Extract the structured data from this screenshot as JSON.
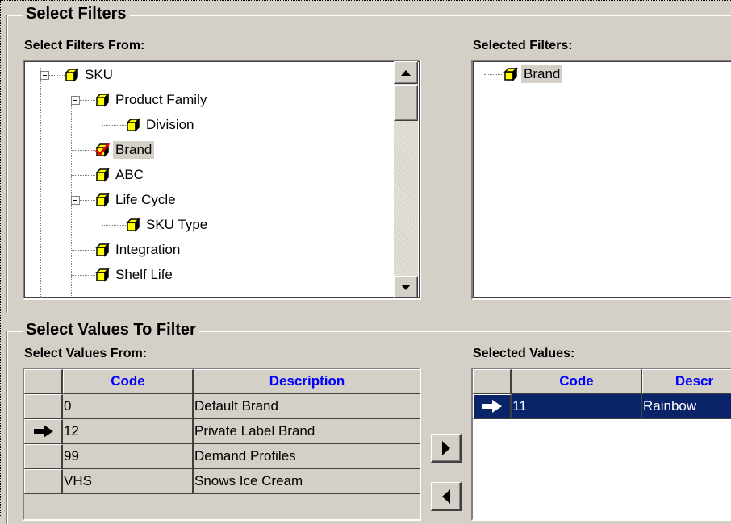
{
  "filters": {
    "group_title": "Select Filters",
    "from_label": "Select Filters From:",
    "selected_label": "Selected Filters:",
    "tree": [
      {
        "label": "SKU",
        "checked": false,
        "selected": false
      },
      {
        "label": "Product Family",
        "checked": false,
        "selected": false
      },
      {
        "label": "Division",
        "checked": false,
        "selected": false
      },
      {
        "label": "Brand",
        "checked": true,
        "selected": true
      },
      {
        "label": "ABC",
        "checked": false,
        "selected": false
      },
      {
        "label": "Life Cycle",
        "checked": false,
        "selected": false
      },
      {
        "label": "SKU Type",
        "checked": false,
        "selected": false
      },
      {
        "label": "Integration",
        "checked": false,
        "selected": false
      },
      {
        "label": "Shelf Life",
        "checked": false,
        "selected": false
      }
    ],
    "selected": [
      {
        "label": "Brand"
      }
    ]
  },
  "values": {
    "group_title": "Select Values To Filter",
    "from_label": "Select Values From:",
    "selected_label": "Selected Values:",
    "columns": [
      "Code",
      "Description"
    ],
    "right_columns": [
      "Code",
      "Descr"
    ],
    "rows": [
      {
        "code": "0",
        "description": "Default Brand",
        "current": false
      },
      {
        "code": "12",
        "description": "Private Label Brand",
        "current": true
      },
      {
        "code": "99",
        "description": "Demand Profiles",
        "current": false
      },
      {
        "code": "VHS",
        "description": "Snows Ice Cream",
        "current": false
      }
    ],
    "selected_rows": [
      {
        "code": "11",
        "description": "Rainbow",
        "current": true
      }
    ]
  },
  "icons": {
    "node": "yellow-cube-icon",
    "checked_node": "checked-cube-icon",
    "row_pointer": "arrow-right-icon",
    "add": "triangle-right-icon",
    "remove": "triangle-left-icon",
    "scroll_up": "triangle-up-icon",
    "scroll_down": "triangle-down-icon"
  },
  "colors": {
    "header_text": "#0000ff",
    "selection": "#0a246a",
    "cube": "#ffff00",
    "window": "#d4d0c8"
  }
}
